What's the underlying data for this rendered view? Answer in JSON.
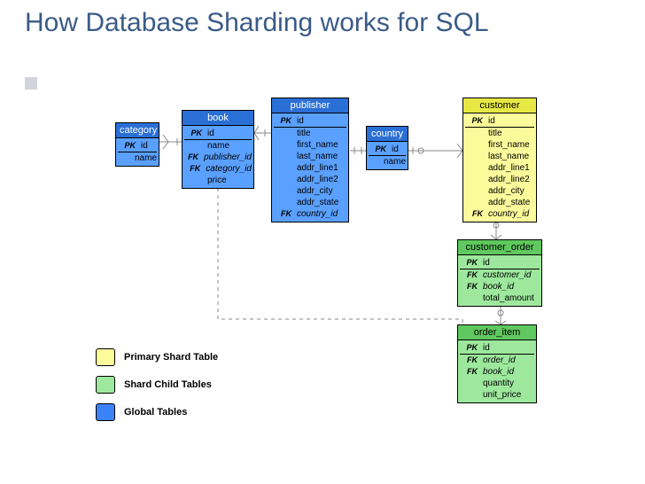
{
  "title": "How Database Sharding works for SQL",
  "entities": {
    "category": {
      "name": "category",
      "pk": "id",
      "attrs": [
        "name"
      ]
    },
    "book": {
      "name": "book",
      "pk": "id",
      "attrs": [
        "name"
      ],
      "fks": [
        "publisher_id",
        "category_id"
      ],
      "tail": [
        "price"
      ]
    },
    "publisher": {
      "name": "publisher",
      "pk": "id",
      "attrs": [
        "title",
        "first_name",
        "last_name",
        "addr_line1",
        "addr_line2",
        "addr_city",
        "addr_state"
      ],
      "fks": [
        "country_id"
      ]
    },
    "country": {
      "name": "country",
      "pk": "id",
      "attrs": [
        "name"
      ]
    },
    "customer": {
      "name": "customer",
      "pk": "id",
      "attrs": [
        "title",
        "first_name",
        "last_name",
        "addr_line1",
        "addr_line2",
        "addr_city",
        "addr_state"
      ],
      "fks": [
        "country_id"
      ]
    },
    "customer_order": {
      "name": "customer_order",
      "pk": "id",
      "fks": [
        "customer_id",
        "book_id"
      ],
      "tail": [
        "total_amount"
      ]
    },
    "order_item": {
      "name": "order_item",
      "pk": "id",
      "fks": [
        "order_id",
        "book_id"
      ],
      "tail": [
        "quantity",
        "unit_price"
      ]
    }
  },
  "key_labels": {
    "pk": "PK",
    "fk": "FK"
  },
  "legend": {
    "primary": "Primary Shard Table",
    "child": "Shard Child Tables",
    "global": "Global Tables"
  }
}
